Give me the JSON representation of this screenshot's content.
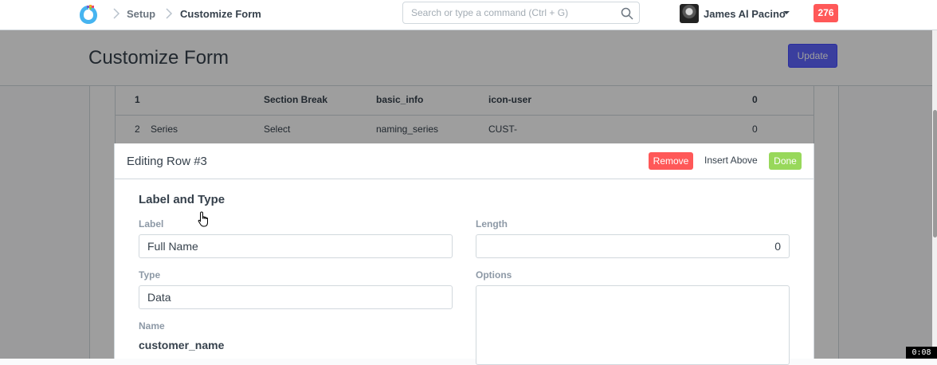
{
  "navbar": {
    "breadcrumbs": [
      "Setup",
      "Customize Form"
    ],
    "search_placeholder": "Search or type a command (Ctrl + G)",
    "user_name": "James Al Pacino",
    "notification_count": "276"
  },
  "page": {
    "title": "Customize Form",
    "update_label": "Update"
  },
  "grid": {
    "rows": [
      {
        "idx": "1",
        "label": "",
        "type": "Section Break",
        "fieldname": "basic_info",
        "options": "icon-user",
        "length": "0"
      },
      {
        "idx": "2",
        "label": "Series",
        "type": "Select",
        "fieldname": "naming_series",
        "options": "CUST-",
        "length": "0"
      }
    ]
  },
  "editor": {
    "title": "Editing Row #3",
    "remove_label": "Remove",
    "insert_above_label": "Insert Above",
    "done_label": "Done",
    "section_title": "Label and Type",
    "label_field": {
      "label": "Label",
      "value": "Full Name"
    },
    "length_field": {
      "label": "Length",
      "value": "0"
    },
    "type_field": {
      "label": "Type",
      "value": "Data"
    },
    "options_field": {
      "label": "Options",
      "value": ""
    },
    "name_field": {
      "label": "Name",
      "value": "customer_name"
    }
  },
  "timer": "0:08",
  "colors": {
    "primary": "#5e64ff",
    "danger": "#ff5858",
    "success": "#98d85b"
  },
  "icons": [
    "app-logo-icon",
    "chevron-right-icon",
    "search-icon",
    "caret-down-icon",
    "pointer-cursor-icon"
  ]
}
